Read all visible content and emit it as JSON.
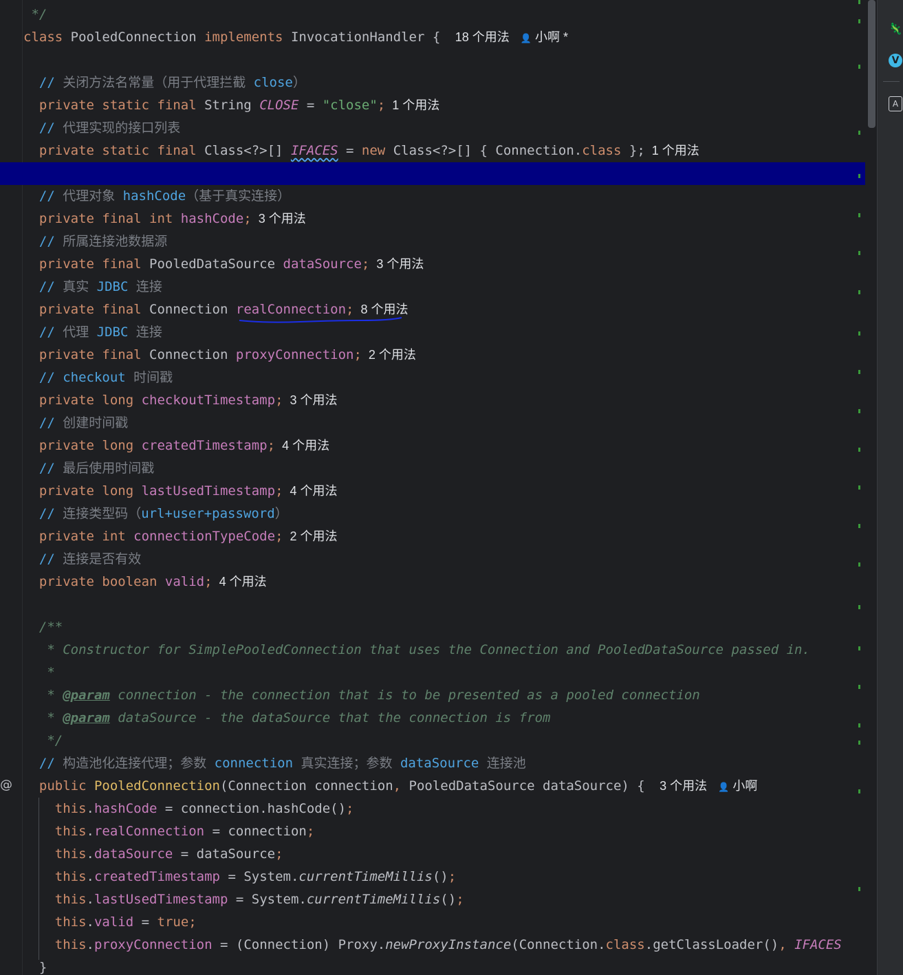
{
  "editor": {
    "lines": [
      [
        {
          "t": " */",
          "c": "dc"
        }
      ],
      [
        {
          "t": "class ",
          "c": "kw"
        },
        {
          "t": "PooledConnection "
        },
        {
          "t": "implements ",
          "c": "kw"
        },
        {
          "t": "InvocationHandler { "
        },
        {
          "t": "18 个用法",
          "c": "hint"
        },
        {
          "t": "👤",
          "c": "ico"
        },
        {
          "t": " 小啊 *",
          "c": "hint2"
        }
      ],
      [],
      [
        {
          "t": "  // ",
          "c": "cmb"
        },
        {
          "t": "关闭方法名常量（用于代理拦截 ",
          "c": "cm"
        },
        {
          "t": "close",
          "c": "cmb"
        },
        {
          "t": "）",
          "c": "cm"
        }
      ],
      [
        {
          "t": "  private static final ",
          "c": "kw"
        },
        {
          "t": "String "
        },
        {
          "t": "CLOSE",
          "c": "st"
        },
        {
          "t": " = "
        },
        {
          "t": "\"close\"",
          "c": "str"
        },
        {
          "t": ";",
          "c": "kw"
        },
        {
          "t": "1 个用法",
          "c": "hint"
        }
      ],
      [
        {
          "t": "  // ",
          "c": "cmb"
        },
        {
          "t": "代理实现的接口列表",
          "c": "cm"
        }
      ],
      [
        {
          "t": "  private static final ",
          "c": "kw"
        },
        {
          "t": "Class<?>[] "
        },
        {
          "t": "IFACES",
          "c": "st wavy"
        },
        {
          "t": " = "
        },
        {
          "t": "new ",
          "c": "kw"
        },
        {
          "t": "Class<?>[] { Connection."
        },
        {
          "t": "class",
          "c": "kw"
        },
        {
          "t": " };"
        },
        {
          "t": "1 个用法",
          "c": "hint"
        }
      ],
      [],
      [
        {
          "t": "  // ",
          "c": "cmb"
        },
        {
          "t": "代理对象 ",
          "c": "cm"
        },
        {
          "t": "hashCode",
          "c": "cmb"
        },
        {
          "t": "（基于真实连接）",
          "c": "cm"
        }
      ],
      [
        {
          "t": "  private final int ",
          "c": "kw"
        },
        {
          "t": "hashCode",
          "c": "fld"
        },
        {
          "t": ";",
          "c": "kw"
        },
        {
          "t": "3 个用法",
          "c": "hint"
        }
      ],
      [
        {
          "t": "  // ",
          "c": "cmb"
        },
        {
          "t": "所属连接池数据源",
          "c": "cm"
        }
      ],
      [
        {
          "t": "  private final ",
          "c": "kw"
        },
        {
          "t": "PooledDataSource "
        },
        {
          "t": "dataSource",
          "c": "fld"
        },
        {
          "t": ";",
          "c": "kw"
        },
        {
          "t": "3 个用法",
          "c": "hint"
        }
      ],
      [
        {
          "t": "  // ",
          "c": "cmb"
        },
        {
          "t": "真实 ",
          "c": "cm"
        },
        {
          "t": "JDBC",
          "c": "cmb"
        },
        {
          "t": " 连接",
          "c": "cm"
        }
      ],
      [
        {
          "t": "  private final ",
          "c": "kw"
        },
        {
          "t": "Connection "
        },
        {
          "t": "realConnection",
          "c": "fld"
        },
        {
          "t": ";",
          "c": "kw"
        },
        {
          "t": "8 个用法",
          "c": "hint"
        }
      ],
      [
        {
          "t": "  // ",
          "c": "cmb"
        },
        {
          "t": "代理 ",
          "c": "cm"
        },
        {
          "t": "JDBC",
          "c": "cmb"
        },
        {
          "t": " 连接",
          "c": "cm"
        }
      ],
      [
        {
          "t": "  private final ",
          "c": "kw"
        },
        {
          "t": "Connection "
        },
        {
          "t": "proxyConnection",
          "c": "fld"
        },
        {
          "t": ";",
          "c": "kw"
        },
        {
          "t": "2 个用法",
          "c": "hint"
        }
      ],
      [
        {
          "t": "  // ",
          "c": "cmb"
        },
        {
          "t": "checkout",
          "c": "cmb"
        },
        {
          "t": " 时间戳",
          "c": "cm"
        }
      ],
      [
        {
          "t": "  private long ",
          "c": "kw"
        },
        {
          "t": "checkoutTimestamp",
          "c": "fld"
        },
        {
          "t": ";",
          "c": "kw"
        },
        {
          "t": "3 个用法",
          "c": "hint"
        }
      ],
      [
        {
          "t": "  // ",
          "c": "cmb"
        },
        {
          "t": "创建时间戳",
          "c": "cm"
        }
      ],
      [
        {
          "t": "  private long ",
          "c": "kw"
        },
        {
          "t": "createdTimestamp",
          "c": "fld"
        },
        {
          "t": ";",
          "c": "kw"
        },
        {
          "t": "4 个用法",
          "c": "hint"
        }
      ],
      [
        {
          "t": "  // ",
          "c": "cmb"
        },
        {
          "t": "最后使用时间戳",
          "c": "cm"
        }
      ],
      [
        {
          "t": "  private long ",
          "c": "kw"
        },
        {
          "t": "lastUsedTimestamp",
          "c": "fld"
        },
        {
          "t": ";",
          "c": "kw"
        },
        {
          "t": "4 个用法",
          "c": "hint"
        }
      ],
      [
        {
          "t": "  // ",
          "c": "cmb"
        },
        {
          "t": "连接类型码（",
          "c": "cm"
        },
        {
          "t": "url+user+password",
          "c": "cmb"
        },
        {
          "t": "）",
          "c": "cm"
        }
      ],
      [
        {
          "t": "  private int ",
          "c": "kw"
        },
        {
          "t": "connectionTypeCode",
          "c": "fld"
        },
        {
          "t": ";",
          "c": "kw"
        },
        {
          "t": "2 个用法",
          "c": "hint"
        }
      ],
      [
        {
          "t": "  // ",
          "c": "cmb"
        },
        {
          "t": "连接是否有效",
          "c": "cm"
        }
      ],
      [
        {
          "t": "  private boolean ",
          "c": "kw"
        },
        {
          "t": "valid",
          "c": "fld"
        },
        {
          "t": ";",
          "c": "kw"
        },
        {
          "t": "4 个用法",
          "c": "hint"
        }
      ],
      [],
      [
        {
          "t": "  /**",
          "c": "dc"
        }
      ],
      [
        {
          "t": "   * Constructor for SimplePooledConnection that uses the Connection and PooledDataSource passed in.",
          "c": "dc"
        }
      ],
      [
        {
          "t": "   *",
          "c": "dc"
        }
      ],
      [
        {
          "t": "   * ",
          "c": "dc"
        },
        {
          "t": "@param",
          "c": "dtag"
        },
        {
          "t": " connection",
          "c": "dc"
        },
        {
          "t": " - the connection that is to be presented as a pooled connection",
          "c": "dc"
        }
      ],
      [
        {
          "t": "   * ",
          "c": "dc"
        },
        {
          "t": "@param",
          "c": "dtag"
        },
        {
          "t": " dataSource",
          "c": "dc"
        },
        {
          "t": " - the dataSource that the connection is from",
          "c": "dc"
        }
      ],
      [
        {
          "t": "   */",
          "c": "dc"
        }
      ],
      [
        {
          "t": "  // ",
          "c": "cmb"
        },
        {
          "t": "构造池化连接代理；参数 ",
          "c": "cm"
        },
        {
          "t": "connection",
          "c": "cmb"
        },
        {
          "t": " 真实连接；参数 ",
          "c": "cm"
        },
        {
          "t": "dataSource",
          "c": "cmb"
        },
        {
          "t": " 连接池",
          "c": "cm"
        }
      ],
      [
        {
          "t": "  public ",
          "c": "kw"
        },
        {
          "t": "PooledConnection",
          "c": "mt2"
        },
        {
          "t": "(Connection connection"
        },
        {
          "t": ", ",
          "c": "kw"
        },
        {
          "t": "PooledDataSource dataSource) { "
        },
        {
          "t": "3 个用法",
          "c": "hint"
        },
        {
          "t": "👤",
          "c": "ico"
        },
        {
          "t": " 小啊",
          "c": "hint2"
        }
      ],
      [
        {
          "t": "    this",
          "c": "kw"
        },
        {
          "t": "."
        },
        {
          "t": "hashCode",
          "c": "fld"
        },
        {
          "t": " = connection.hashCode()"
        },
        {
          "t": ";",
          "c": "kw"
        }
      ],
      [
        {
          "t": "    this",
          "c": "kw"
        },
        {
          "t": "."
        },
        {
          "t": "realConnection",
          "c": "fld"
        },
        {
          "t": " = connection"
        },
        {
          "t": ";",
          "c": "kw"
        }
      ],
      [
        {
          "t": "    this",
          "c": "kw"
        },
        {
          "t": "."
        },
        {
          "t": "dataSource",
          "c": "fld"
        },
        {
          "t": " = dataSource"
        },
        {
          "t": ";",
          "c": "kw"
        }
      ],
      [
        {
          "t": "    this",
          "c": "kw"
        },
        {
          "t": "."
        },
        {
          "t": "createdTimestamp",
          "c": "fld"
        },
        {
          "t": " = System."
        },
        {
          "t": "currentTimeMillis",
          "c": "it"
        },
        {
          "t": "()"
        },
        {
          "t": ";",
          "c": "kw"
        }
      ],
      [
        {
          "t": "    this",
          "c": "kw"
        },
        {
          "t": "."
        },
        {
          "t": "lastUsedTimestamp",
          "c": "fld"
        },
        {
          "t": " = System."
        },
        {
          "t": "currentTimeMillis",
          "c": "it"
        },
        {
          "t": "()"
        },
        {
          "t": ";",
          "c": "kw"
        }
      ],
      [
        {
          "t": "    this",
          "c": "kw"
        },
        {
          "t": "."
        },
        {
          "t": "valid",
          "c": "fld"
        },
        {
          "t": " = "
        },
        {
          "t": "true",
          "c": "kw"
        },
        {
          "t": ";",
          "c": "kw"
        }
      ],
      [
        {
          "t": "    this",
          "c": "kw"
        },
        {
          "t": "."
        },
        {
          "t": "proxyConnection",
          "c": "fld"
        },
        {
          "t": " = (Connection) Proxy."
        },
        {
          "t": "newProxyInstance",
          "c": "it"
        },
        {
          "t": "(Connection."
        },
        {
          "t": "class",
          "c": "kw"
        },
        {
          "t": ".getClassLoader()"
        },
        {
          "t": ", ",
          "c": "kw"
        },
        {
          "t": "IFACES",
          "c": "st"
        }
      ],
      [
        {
          "t": "  }"
        }
      ]
    ],
    "current_line_index": 7,
    "gutter_symbol": "@"
  },
  "sidebar": {
    "icons": [
      "lizard-icon",
      "vue-icon",
      "translate-icon"
    ],
    "vue_label": "V",
    "translate_label": "A"
  },
  "colors": {
    "background": "#1e1f22",
    "keyword": "#cf8e6d",
    "field": "#c77dbb",
    "string": "#6aab73",
    "doc_comment": "#5f826b",
    "current_line": "#000080"
  }
}
